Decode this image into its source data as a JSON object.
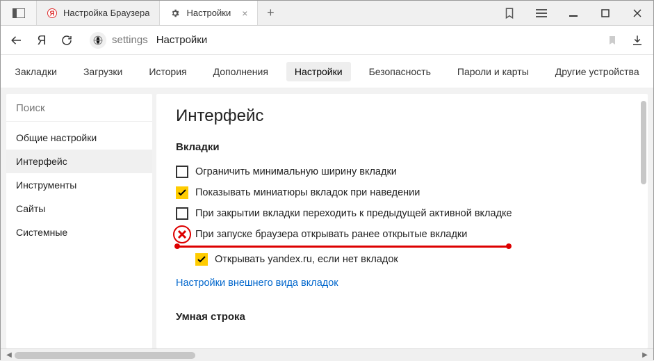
{
  "titlebar": {
    "tabs": [
      {
        "title": "Настройка Браузера",
        "favicon": "yandex",
        "active": false
      },
      {
        "title": "Настройки",
        "favicon": "gear",
        "active": true
      }
    ]
  },
  "addressbar": {
    "url_host": "settings",
    "url_title": "Настройки"
  },
  "nav": {
    "items": [
      "Закладки",
      "Загрузки",
      "История",
      "Дополнения",
      "Настройки",
      "Безопасность",
      "Пароли и карты",
      "Другие устройства"
    ],
    "active_index": 4
  },
  "sidebar": {
    "search_placeholder": "Поиск",
    "items": [
      "Общие настройки",
      "Интерфейс",
      "Инструменты",
      "Сайты",
      "Системные"
    ],
    "active_index": 1
  },
  "content": {
    "heading": "Интерфейс",
    "section1_title": "Вкладки",
    "options": [
      {
        "label": "Ограничить минимальную ширину вкладки",
        "checked": false
      },
      {
        "label": "Показывать миниатюры вкладок при наведении",
        "checked": true
      },
      {
        "label": "При закрытии вкладки переходить к предыдущей активной вкладке",
        "checked": false
      },
      {
        "label": "При запуске браузера открывать ранее открытые вкладки",
        "checked": false,
        "annotated": true
      },
      {
        "label": "Открывать yandex.ru, если нет вкладок",
        "checked": true,
        "indent": true
      }
    ],
    "tabs_appearance_link": "Настройки внешнего вида вкладок",
    "section2_title": "Умная строка"
  }
}
